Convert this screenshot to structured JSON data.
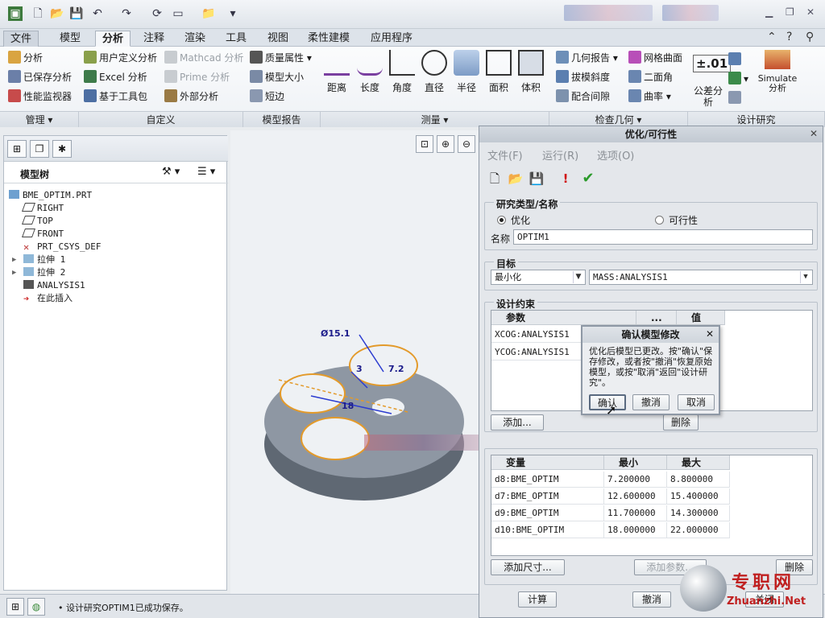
{
  "quick_access": {
    "icons": [
      "app-icon",
      "new-icon",
      "open-icon",
      "save-icon",
      "undo-icon",
      "redo-icon",
      "regenerate-icon",
      "windows-icon",
      "folder-icon",
      "customize-icon"
    ]
  },
  "tabs": [
    "文件",
    "模型",
    "分析",
    "注释",
    "渲染",
    "工具",
    "视图",
    "柔性建模",
    "应用程序"
  ],
  "ribbon": {
    "manage": {
      "items": [
        "分析",
        "已保存分析",
        "性能监视器"
      ],
      "group": "管理"
    },
    "custom": {
      "items": [
        "用户定义分析",
        "Excel 分析",
        "基于工具包",
        "Mathcad 分析",
        "Prime 分析",
        "外部分析"
      ],
      "group": "自定义"
    },
    "model_report": {
      "items": [
        "质量属性",
        "模型大小",
        "短边"
      ],
      "group": "模型报告"
    },
    "measure": {
      "items": [
        "距离",
        "长度",
        "角度",
        "直径",
        "半径",
        "面积",
        "体积"
      ],
      "group": "测量"
    },
    "inspect": {
      "items": [
        "几何报告",
        "拔模斜度",
        "配合间隙",
        "网格曲面",
        "二面角",
        "曲率"
      ],
      "group": "检查几何"
    },
    "design": {
      "items": [
        "±.01",
        "公差分析",
        "Simulate",
        "分析"
      ],
      "group": "设计研究"
    }
  },
  "model_tree": {
    "title": "模型树",
    "items": [
      "BME_OPTIM.PRT",
      "RIGHT",
      "TOP",
      "FRONT",
      "PRT_CSYS_DEF",
      "拉伸 1",
      "拉伸 2",
      "ANALYSIS1",
      "在此插入"
    ]
  },
  "viewport": {
    "dims": [
      "Ø15.1",
      "7.2",
      "18",
      "3"
    ]
  },
  "status": {
    "message": "设计研究OPTIM1已成功保存。"
  },
  "dialog": {
    "title": "优化/可行性",
    "menu": [
      "文件(F)",
      "运行(R)",
      "选项(O)"
    ],
    "study_section": "研究类型/名称",
    "radio_optimize": "优化",
    "radio_feasibility": "可行性",
    "name_label": "名称",
    "name_value": "OPTIM1",
    "goal_section": "目标",
    "goal_type": "最小化",
    "goal_param": "MASS:ANALYSIS1",
    "constraint_section": "设计约束",
    "constraint_headers": [
      "参数",
      "...",
      "值"
    ],
    "constraints": [
      "XCOG:ANALYSIS1",
      "YCOG:ANALYSIS1"
    ],
    "add_button": "添加...",
    "delete_button": "删除",
    "var_headers": [
      "变量",
      "最小",
      "最大"
    ],
    "variables": [
      [
        "d8:BME_OPTIM",
        "7.200000",
        "8.800000"
      ],
      [
        "d7:BME_OPTIM",
        "12.600000",
        "15.400000"
      ],
      [
        "d9:BME_OPTIM",
        "11.700000",
        "14.300000"
      ],
      [
        "d10:BME_OPTIM",
        "18.000000",
        "22.000000"
      ]
    ],
    "add_dim_button": "添加尺寸...",
    "add_param_button": "添加参数...",
    "delete_button2": "删除",
    "compute_button": "计算",
    "cancel_button": "撤消",
    "close_button": "关闭"
  },
  "popup": {
    "title": "确认模型修改",
    "message": "优化后模型已更改。按\"确认\"保存修改，或者按\"撤消\"恢复原始模型，或按\"取消\"返回\"设计研究\"。",
    "confirm": "确认",
    "undo": "撤消",
    "cancel": "取消"
  },
  "watermark": {
    "text": "专职网",
    "url": "Zhuanzhi.Net"
  }
}
